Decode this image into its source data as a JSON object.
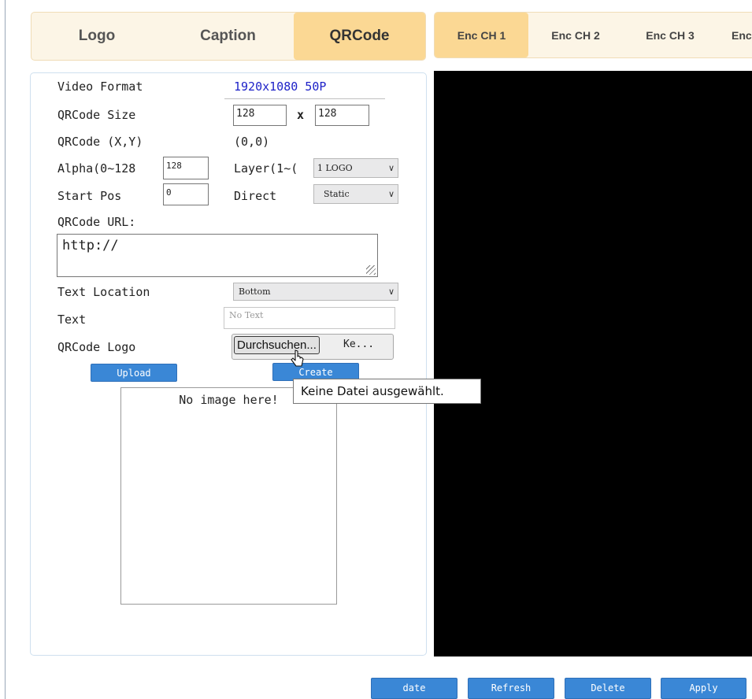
{
  "tabs_left": [
    {
      "label": "Logo",
      "active": false
    },
    {
      "label": "Caption",
      "active": false
    },
    {
      "label": "QRCode",
      "active": true
    }
  ],
  "tabs_right": [
    {
      "label": "Enc CH 1",
      "active": true
    },
    {
      "label": "Enc CH 2",
      "active": false
    },
    {
      "label": "Enc CH 3",
      "active": false
    },
    {
      "label": "Enc",
      "active": false
    }
  ],
  "form": {
    "video_format_label": "Video Format",
    "video_format_value": "1920x1080 50P",
    "size_label": "QRCode Size",
    "size_w": "128",
    "size_x": "x",
    "size_h": "128",
    "pos_label": "QRCode (X,Y)",
    "pos_value": "(0,0)",
    "alpha_label": "Alpha(0~128",
    "alpha_value": "128",
    "layer_label": "Layer(1~(",
    "layer_value": "1 LOGO",
    "start_pos_label": "Start Pos",
    "start_pos_value": "0",
    "direct_label": "Direct",
    "direct_value": "Static",
    "url_label": "QRCode URL:",
    "url_value": "http://",
    "text_location_label": "Text Location",
    "text_location_value": "Bottom",
    "text_label": "Text",
    "text_placeholder": "No Text",
    "logo_label": "QRCode Logo",
    "browse_label": "Durchsuchen...",
    "file_name": "Ke...",
    "upload_label": "Upload",
    "create_label": "Create",
    "preview_text": "No image here!"
  },
  "tooltip": "Keine Datei ausgewählt.",
  "bottom_buttons": [
    "date",
    "Refresh",
    "Delete",
    "Apply"
  ],
  "colors": {
    "tab_active": "#fbd894",
    "tab_bar": "#fcf5e6",
    "button_blue": "#3a87d6",
    "value_blue": "#1e22c8",
    "video_bg": "#000000"
  }
}
